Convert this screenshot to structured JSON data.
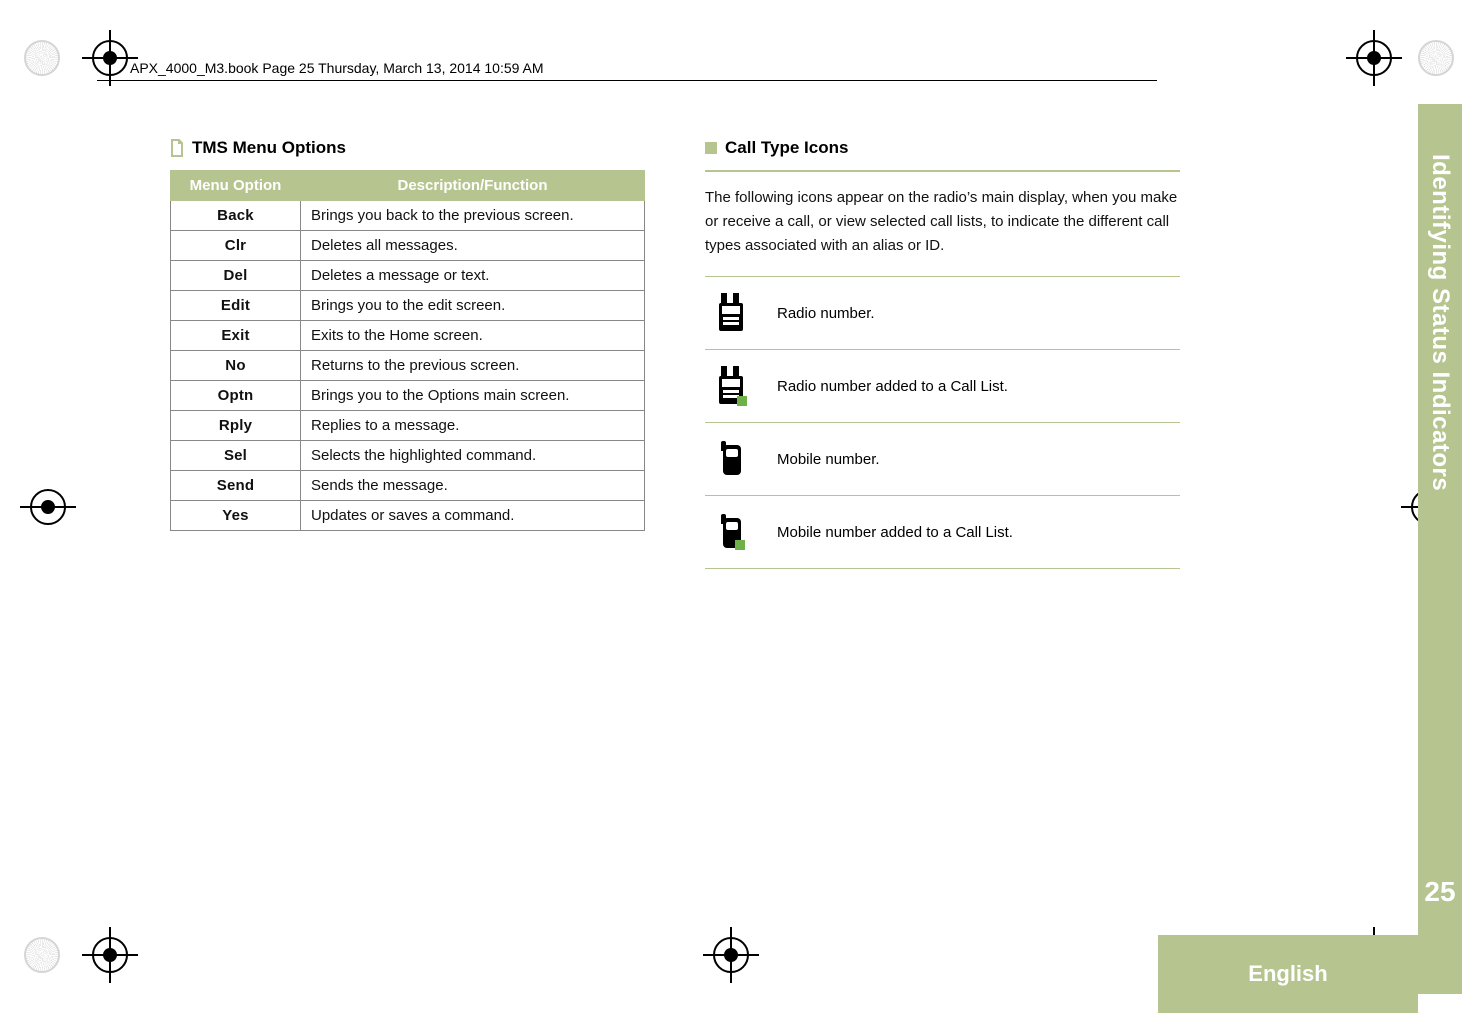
{
  "header_note": "APX_4000_M3.book  Page 25  Thursday, March 13, 2014  10:59 AM",
  "page_number": "25",
  "language": "English",
  "side_title": "Identifying Status Indicators",
  "left": {
    "section_title": "TMS Menu Options",
    "th1": "Menu Option",
    "th2": "Description/Function",
    "rows": [
      {
        "opt": "Back",
        "desc": "Brings you back to the previous screen."
      },
      {
        "opt": "Clr",
        "desc": "Deletes all messages."
      },
      {
        "opt": "Del",
        "desc": "Deletes a message or text."
      },
      {
        "opt": "Edit",
        "desc": "Brings you to the edit screen."
      },
      {
        "opt": "Exit",
        "desc": "Exits to the Home screen."
      },
      {
        "opt": "No",
        "desc": "Returns to the previous screen."
      },
      {
        "opt": "Optn",
        "desc": "Brings you to the Options main screen."
      },
      {
        "opt": "Rply",
        "desc": "Replies to a message."
      },
      {
        "opt": "Sel",
        "desc": "Selects the highlighted command."
      },
      {
        "opt": "Send",
        "desc": "Sends the message."
      },
      {
        "opt": "Yes",
        "desc": "Updates or saves a command."
      }
    ]
  },
  "right": {
    "section_title": "Call Type Icons",
    "intro": "The following icons appear on the radio’s main display, when you make or receive a call, or view selected call lists, to indicate the different call types associated with an alias or ID.",
    "rows": [
      {
        "desc": "Radio number."
      },
      {
        "desc": "Radio number added to a Call List."
      },
      {
        "desc": "Mobile number."
      },
      {
        "desc": "Mobile number added to a Call List."
      }
    ]
  }
}
